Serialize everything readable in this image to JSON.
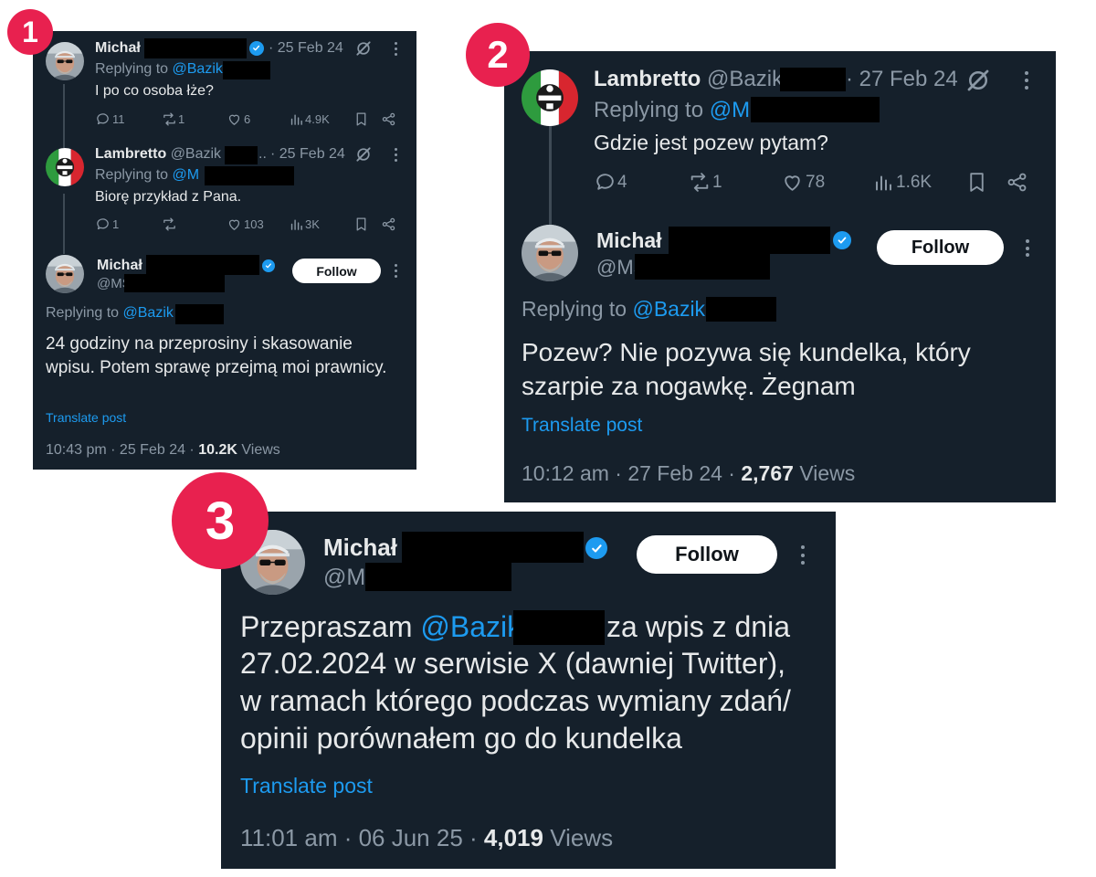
{
  "badges": {
    "one": "1",
    "two": "2",
    "three": "3"
  },
  "panel1": {
    "tweet1": {
      "name": "Michał",
      "date": "· 25 Feb 24",
      "replying_label": "Replying to",
      "replying_handle": "@Bazik",
      "text": "I po co osoba łże?",
      "replies": "11",
      "reposts": "1",
      "likes": "6",
      "views": "4.9K"
    },
    "tweet2": {
      "name": "Lambretto",
      "handle": "@Bazik",
      "ellipsis": "..",
      "date": "· 25 Feb 24",
      "replying_label": "Replying to",
      "replying_handle": "@M",
      "text": "Biorę przykład z Pana.",
      "replies": "1",
      "reposts": "",
      "likes": "103",
      "views": "3K"
    },
    "main": {
      "name": "Michał",
      "handle": "@MS",
      "follow": "Follow",
      "replying_label": "Replying to",
      "replying_handle": "@Bazik",
      "text": "24 godziny na przeprosiny i skasowanie wpisu. Potem sprawę przejmą moi prawnicy.",
      "translate": "Translate post",
      "time_date": "10:43 pm · 25 Feb 24 ·",
      "views_count": "10.2K",
      "views_label": "Views"
    }
  },
  "panel2": {
    "tweet1": {
      "name": "Lambretto",
      "handle": "@Bazik",
      "date": "· 27 Feb 24",
      "replying_label": "Replying to",
      "replying_handle": "@MS",
      "text": "Gdzie jest pozew pytam?",
      "replies": "4",
      "reposts": "1",
      "likes": "78",
      "views": "1.6K"
    },
    "main": {
      "name": "Michał",
      "handle": "@MS",
      "follow": "Follow",
      "replying_label": "Replying to",
      "replying_handle": "@Bazik",
      "text": "Pozew? Nie pozywa się kundelka, który szarpie za nogawkę. Żegnam",
      "translate": "Translate post",
      "time_date": "10:12 am · 27 Feb 24 ·",
      "views_count": "2,767",
      "views_label": "Views"
    }
  },
  "panel3": {
    "main": {
      "name": "Michał",
      "handle": "@M",
      "follow": "Follow",
      "text_before": "Przepraszam",
      "mention": "@Bazik",
      "text_line1_end": "za wpis z dnia",
      "text_line2": "27.02.2024 w serwisie X (dawniej Twitter),",
      "text_line3": "w ramach którego podczas wymiany zdań/",
      "text_line4": "opinii porównałem go do kundelka",
      "translate": "Translate post",
      "time_date": "11:01 am · 06 Jun 25 ·",
      "views_count": "4,019",
      "views_label": "Views"
    }
  },
  "colors": {
    "background": "#15202b",
    "accent": "#1d9bf0",
    "badge": "#e8214f",
    "text": "#e7e9ea",
    "muted": "#8b98a5"
  },
  "icons": [
    "reply-icon",
    "repost-icon",
    "like-icon",
    "views-icon",
    "bookmark-icon",
    "share-icon",
    "grok-icon",
    "more-icon",
    "verified-icon"
  ]
}
